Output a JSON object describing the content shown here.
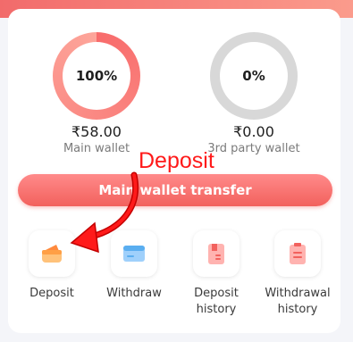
{
  "main_wallet": {
    "percent": "100%",
    "amount": "₹58.00",
    "label": "Main wallet"
  },
  "third_party_wallet": {
    "percent": "0%",
    "amount": "₹0.00",
    "label": "3rd party wallet"
  },
  "transfer_button_label": "Main wallet transfer",
  "annotation_label": "Deposit",
  "actions": [
    {
      "label": "Deposit",
      "icon": "deposit-icon"
    },
    {
      "label": "Withdraw",
      "icon": "withdraw-icon"
    },
    {
      "label": "Deposit history",
      "icon": "deposit-history-icon"
    },
    {
      "label": "Withdrawal history",
      "icon": "withdrawal-history-icon"
    }
  ],
  "colors": {
    "accent": "#f2615d",
    "annotation": "#ff1a1a",
    "ring_empty": "#d8d8d8",
    "withdraw_blue": "#5aaef0"
  }
}
